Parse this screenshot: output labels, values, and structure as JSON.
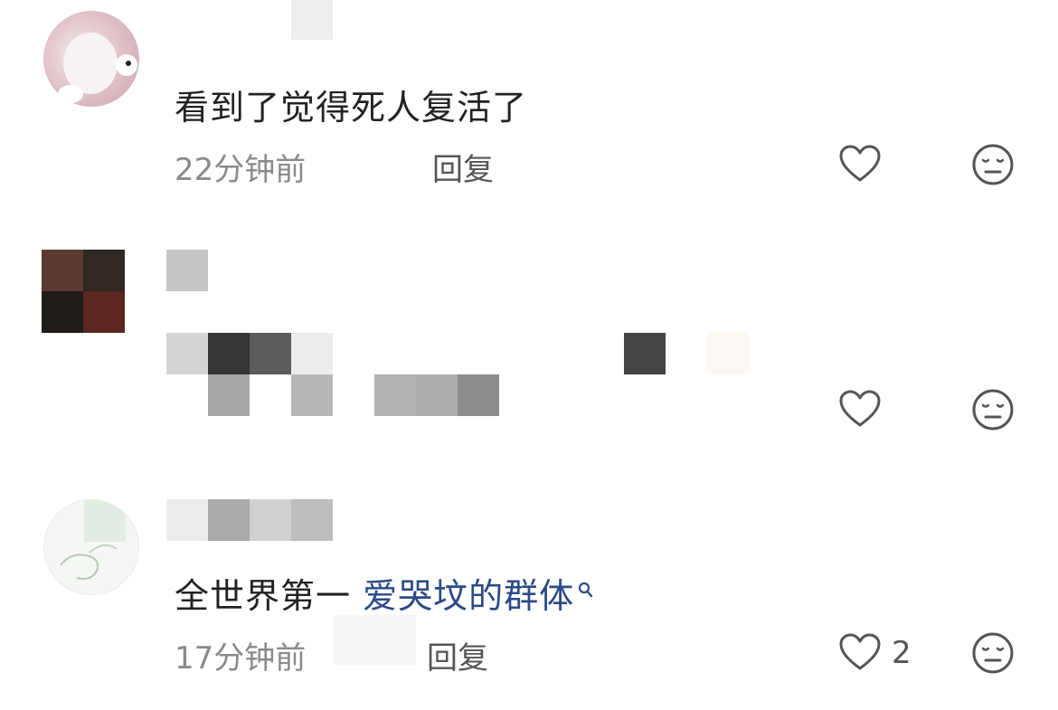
{
  "comments": [
    {
      "text": "看到了觉得死人复活了",
      "time": "22分钟前",
      "reply_label": "回复",
      "like_icon": "heart-outline-icon",
      "dislike_icon": "meh-face-icon"
    },
    {
      "like_icon": "heart-outline-icon",
      "dislike_icon": "meh-face-icon"
    },
    {
      "text_plain": "全世界第一 ",
      "text_link": "爱哭坟的群体",
      "search_icon": "search-icon",
      "time": "17分钟前",
      "reply_label": "回复",
      "like_count": "2",
      "like_icon": "heart-outline-icon",
      "dislike_icon": "meh-face-icon"
    }
  ],
  "colors": {
    "text": "#222222",
    "meta": "#8a8a8a",
    "link": "#2b4a86",
    "icon": "#555555"
  }
}
